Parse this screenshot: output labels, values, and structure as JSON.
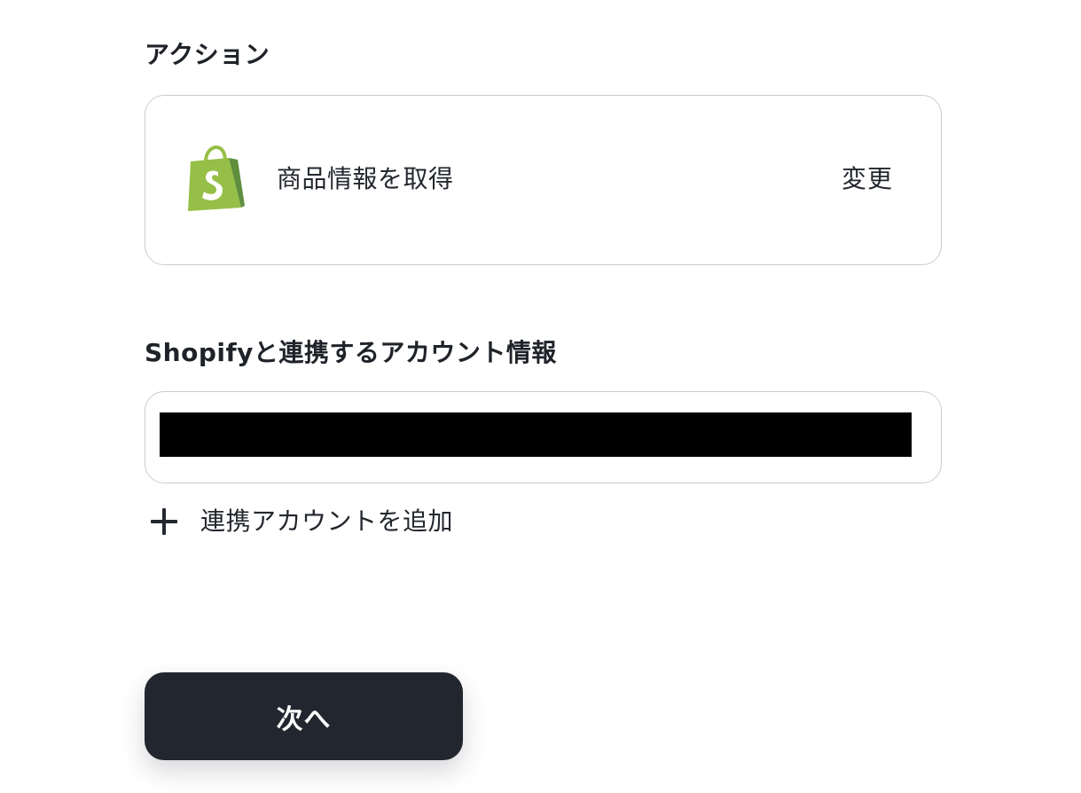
{
  "action_section": {
    "label": "アクション",
    "app_icon": "shopify-bag-icon",
    "action_name": "商品情報を取得",
    "change_label": "変更"
  },
  "account_section": {
    "label": "Shopifyと連携するアカウント情報",
    "selected_account": "[redacted]",
    "add_account_icon": "plus-icon",
    "add_account_label": "連携アカウントを追加"
  },
  "footer": {
    "next_label": "次へ"
  },
  "colors": {
    "text": "#23272e",
    "border": "#c9cdd4",
    "button_bg": "#22272f",
    "button_text": "#ffffff",
    "shopify_green": "#95bf47",
    "shopify_dark_green": "#5e8e3e"
  }
}
